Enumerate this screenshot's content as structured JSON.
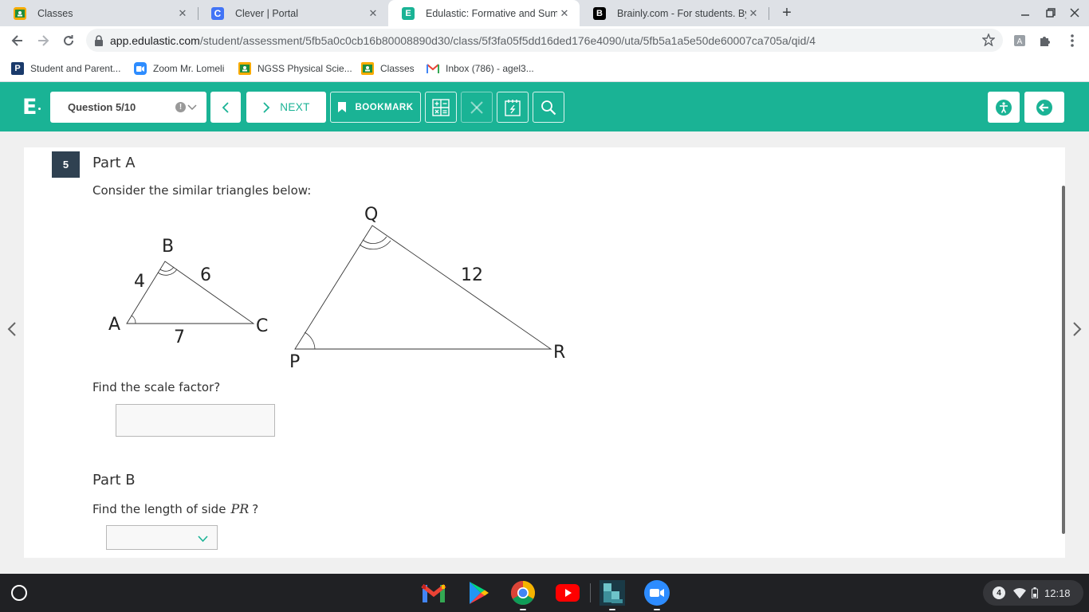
{
  "browser": {
    "tabs": [
      {
        "title": "Classes",
        "active": false
      },
      {
        "title": "Clever | Portal",
        "active": false
      },
      {
        "title": "Edulastic: Formative and Summative Assessments Made Easy",
        "active": true
      },
      {
        "title": "Brainly.com - For students. By students.",
        "active": false
      }
    ],
    "url_host": "app.edulastic.com",
    "url_path": "/student/assessment/5fb5a0c0cb16b80008890d30/class/5f3fa05f5dd16ded176e4090/uta/5fb5a1a5e50de60007ca705a/qid/4",
    "bookmarks": [
      {
        "label": "Student and Parent..."
      },
      {
        "label": "Zoom Mr. Lomeli"
      },
      {
        "label": "NGSS Physical Scie..."
      },
      {
        "label": "Classes"
      },
      {
        "label": "Inbox (786) - agel3..."
      }
    ]
  },
  "header": {
    "logo": "E",
    "question_label": "Question 5/10",
    "warn_glyph": "!",
    "next_label": "NEXT",
    "bookmark_label": "BOOKMARK"
  },
  "question": {
    "number": "5",
    "part_a_title": "Part A",
    "prompt": "Consider the similar triangles below:",
    "part_a_question": "Find the scale factor?",
    "part_a_answer": "",
    "part_b_title": "Part B",
    "part_b_prefix": "Find the length of side",
    "part_b_var": "PR",
    "part_b_suffix": "?",
    "part_b_selected": ""
  },
  "diagram": {
    "small": {
      "A": "A",
      "B": "B",
      "C": "C",
      "AB": "4",
      "BC": "6",
      "AC": "7"
    },
    "large": {
      "P": "P",
      "Q": "Q",
      "R": "R",
      "QR": "12"
    }
  },
  "shelf": {
    "notifications": "4",
    "time": "12:18"
  },
  "colors": {
    "brand": "#1ab395",
    "question_badge": "#2f4151"
  }
}
